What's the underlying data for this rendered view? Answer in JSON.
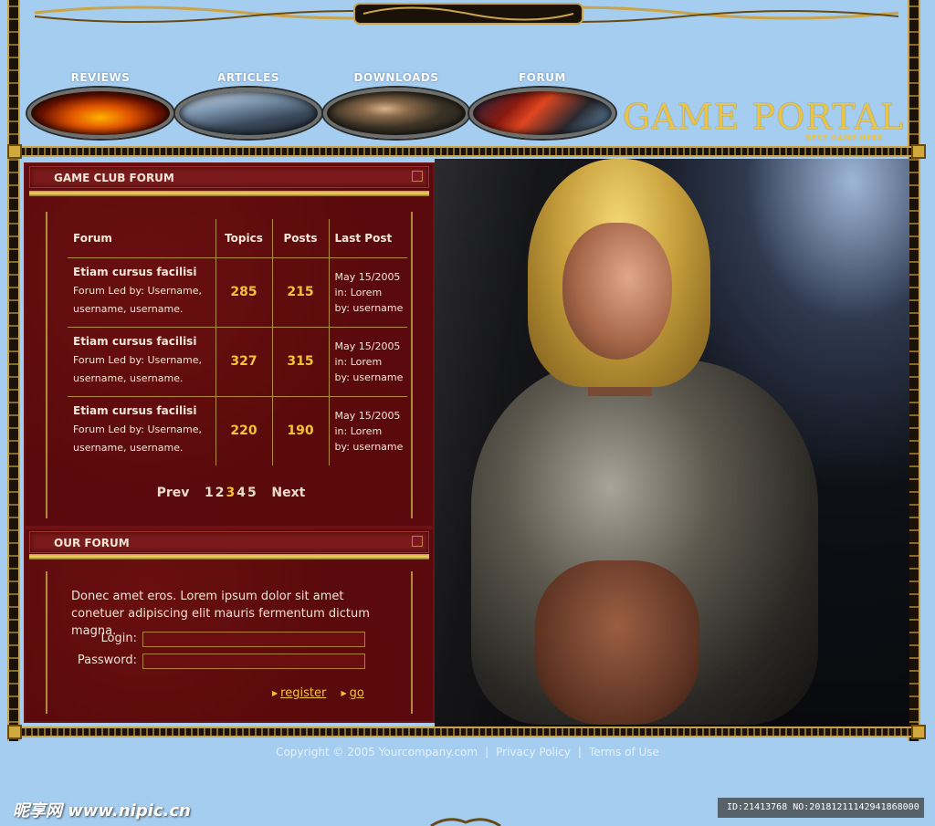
{
  "nav": {
    "items": [
      {
        "label": "REVIEWS"
      },
      {
        "label": "ARTICLES"
      },
      {
        "label": "DOWNLOADS"
      },
      {
        "label": "FORUM"
      }
    ]
  },
  "logo": {
    "title": "GAME PORTAL",
    "tagline": "BEST GAME HERE"
  },
  "forum_panel": {
    "title": "GAME CLUB FORUM",
    "columns": [
      "Forum",
      "Topics",
      "Posts",
      "Last Post"
    ],
    "rows": [
      {
        "title": "Etiam cursus facilisi",
        "desc1": "Forum Led by: Username,",
        "desc2": "username, username.",
        "topics": "285",
        "posts": "215",
        "date": "May 15/2005",
        "in": "in: Lorem",
        "by": "by: username"
      },
      {
        "title": "Etiam cursus facilisi",
        "desc1": "Forum Led by: Username,",
        "desc2": "username, username.",
        "topics": "327",
        "posts": "315",
        "date": "May 15/2005",
        "in": "in: Lorem",
        "by": "by: username"
      },
      {
        "title": "Etiam cursus facilisi",
        "desc1": "Forum Led by: Username,",
        "desc2": "username, username.",
        "topics": "220",
        "posts": "190",
        "date": "May 15/2005",
        "in": "in: Lorem",
        "by": "by: username"
      }
    ],
    "pager": {
      "prev": "Prev",
      "pages": [
        "1",
        "2",
        "3",
        "4",
        "5"
      ],
      "current": "3",
      "next": "Next"
    }
  },
  "our_forum": {
    "title": "OUR FORUM",
    "text": "Donec amet eros. Lorem ipsum dolor sit amet conetuer adipiscing elit mauris fermentum dictum magna.",
    "login_label": "Login:",
    "password_label": "Password:",
    "register_label": "register",
    "go_label": "go"
  },
  "footer": {
    "copyright": "Copyright © 2005 Yourcompany.com",
    "sep1": "|",
    "privacy": "Privacy Policy",
    "sep2": "|",
    "terms": "Terms of Use"
  },
  "watermark": {
    "left": "昵享网 www.nipic.cn",
    "right": "ID:21413768 NO:20181211142941868000"
  },
  "colors": {
    "background": "#a4cdf0",
    "panel": "#5a0a0c",
    "gold": "#f4c338",
    "logo": "#e8c44a"
  }
}
